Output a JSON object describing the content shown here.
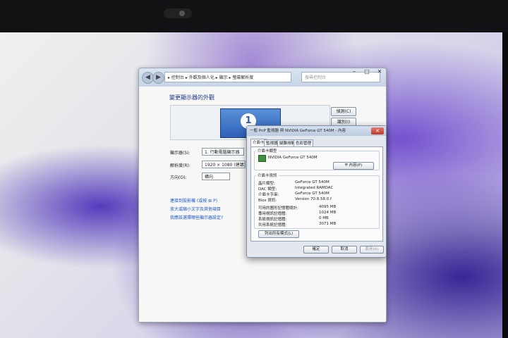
{
  "main_window": {
    "address": "▸ 控制台 ▸ 外觀及個人化 ▸ 顯示 ▸ 螢幕解析度",
    "search_placeholder": "搜尋控制台",
    "title": "變更顯示器的外觀",
    "monitor_number": "1",
    "detect_button": "偵測(C)",
    "identify_button": "識別(I)",
    "display_label": "顯示器(S):",
    "display_value": "1. 行動電腦顯示器",
    "resolution_label": "解析度(R):",
    "resolution_value": "1920 × 1080 (建議)",
    "orientation_label": "方向(O):",
    "orientation_value": "橫向",
    "link_projector": "連接到投影機 (或按",
    "link_projector_tail": "P)",
    "link_text_size": "放大或縮小文字及其他項目",
    "link_help": "我應該選擇哪些顯示器設定?"
  },
  "dialog": {
    "title": "一般 PnP 監視器 與 NVIDIA GeForce GT 540M - 內容",
    "tabs": [
      "介面卡",
      "監視器",
      "疑難排解",
      "色彩管理"
    ],
    "adapter_type_group": "介面卡類型",
    "adapter_name": "NVIDIA GeForce GT 540M",
    "properties_button": "內容(P)",
    "adapter_info_group": "介面卡資訊",
    "info_rows": [
      {
        "label": "晶片類型:",
        "value": "GeForce GT 540M"
      },
      {
        "label": "DAC 類型:",
        "value": "Integrated RAMDAC"
      },
      {
        "label": "介面卡字串:",
        "value": "GeForce GT 540M"
      },
      {
        "label": "Bios 資訊:",
        "value": "Version 70.8.58.0.f"
      }
    ],
    "memory_rows": [
      {
        "label": "可用的圖形記憶體總計:",
        "value": "4095 MB"
      },
      {
        "label": "專用視訊記憶體:",
        "value": "1024 MB"
      },
      {
        "label": "系統視訊記憶體:",
        "value": "0 MB"
      },
      {
        "label": "共用系統記憶體:",
        "value": "3071 MB"
      }
    ],
    "list_modes_button": "列出所有模式(L)",
    "ok_button": "確定",
    "cancel_button": "取消",
    "apply_button": "套用(A)"
  }
}
